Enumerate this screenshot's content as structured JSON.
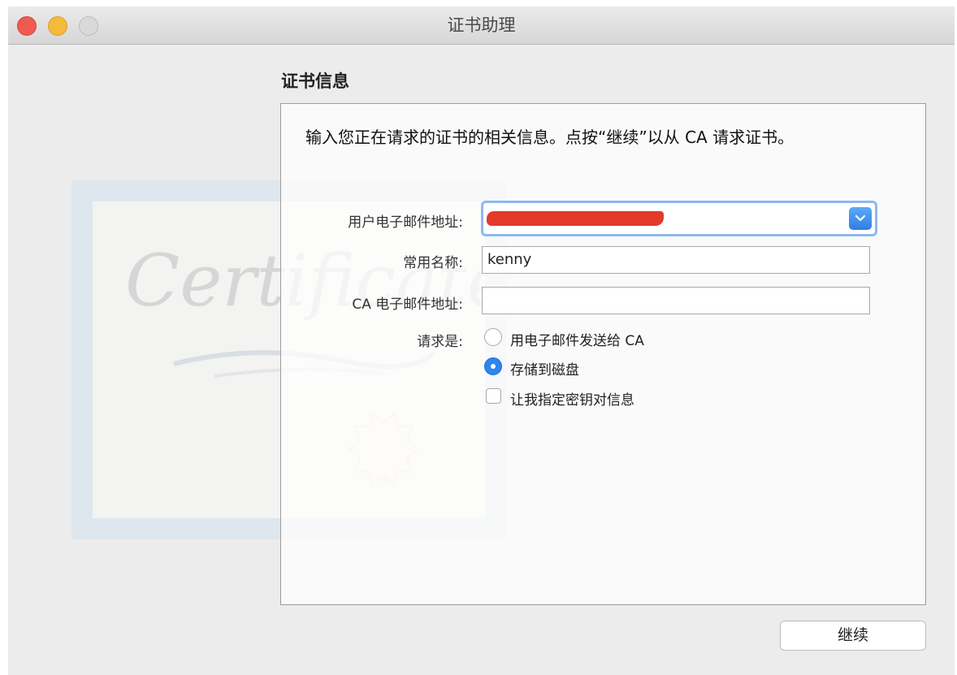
{
  "window": {
    "title": "证书助理"
  },
  "heading": "证书信息",
  "instruction": "输入您正在请求的证书的相关信息。点按“继续”以从 CA 请求证书。",
  "fields": {
    "email_label": "用户电子邮件地址:",
    "email_value": "",
    "common_name_label": "常用名称:",
    "common_name_value": "kenny",
    "ca_email_label": "CA 电子邮件地址:",
    "ca_email_value": ""
  },
  "request": {
    "label": "请求是:",
    "options": [
      {
        "label": "用电子邮件发送给 CA",
        "selected": false
      },
      {
        "label": "存储到磁盘",
        "selected": true
      }
    ],
    "checkbox": {
      "label": "让我指定密钥对信息",
      "checked": false
    }
  },
  "buttons": {
    "continue": "继续"
  },
  "decoration": {
    "certificate_script": "Certificate"
  },
  "colors": {
    "accent": "#2e85ee",
    "close": "#ef5a52",
    "minimize": "#f5b93c",
    "redaction": "#e33a2a"
  }
}
